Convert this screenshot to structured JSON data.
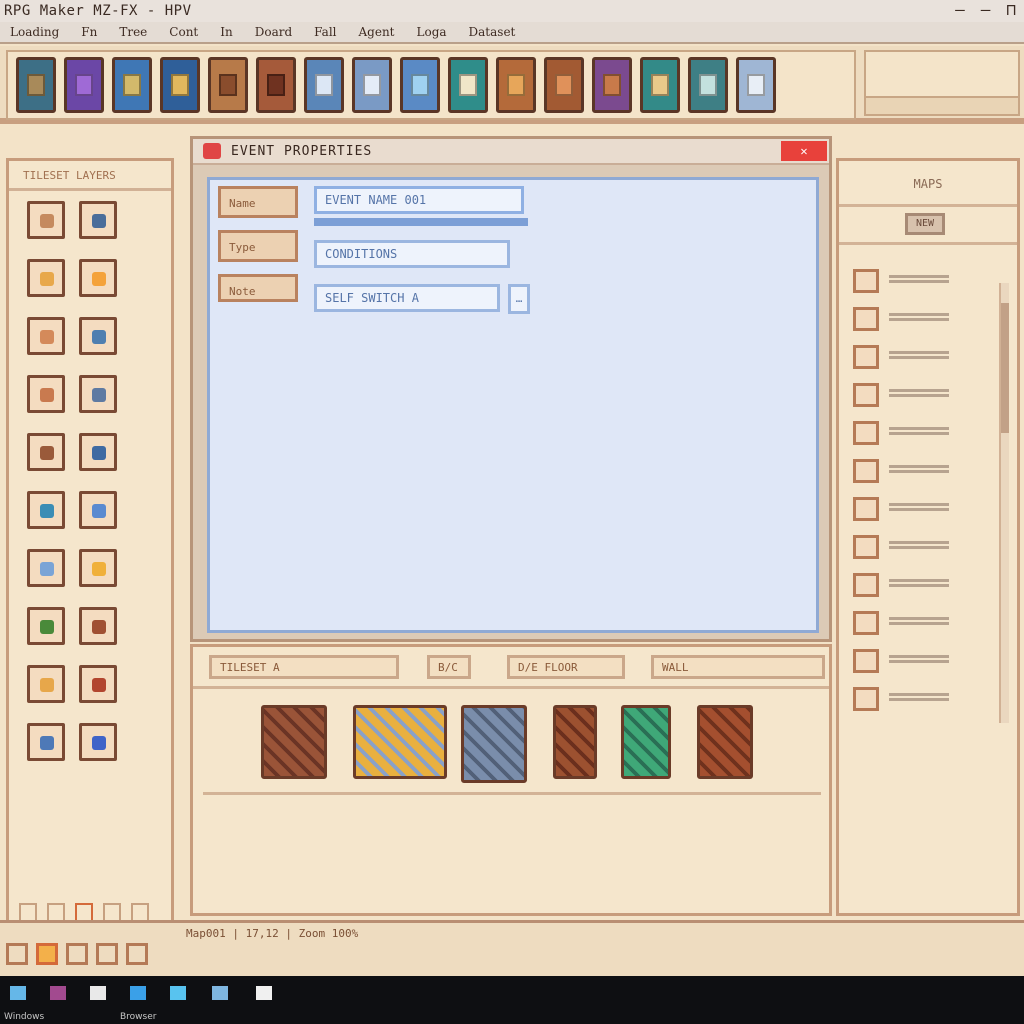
{
  "window": {
    "title": "RPG Maker MZ-FX - HPV",
    "controls": [
      "–",
      "–",
      "⊓"
    ]
  },
  "menu": [
    "Loading",
    "Fn",
    "Tree",
    "Cont",
    "In",
    "Doard",
    "Fall",
    "Agent",
    "Loga",
    "Dataset"
  ],
  "toolbar": {
    "buttons": [
      {
        "name": "map-icon",
        "color": "#3d6f86",
        "accent": "#a88a5a"
      },
      {
        "name": "cart-icon",
        "color": "#6b47a6",
        "accent": "#9f6ad6"
      },
      {
        "name": "sword-icon",
        "color": "#3f77b5",
        "accent": "#d3b96b"
      },
      {
        "name": "shield-icon",
        "color": "#2f5f99",
        "accent": "#e1b85e"
      },
      {
        "name": "tile-brown-icon",
        "color": "#b77a49",
        "accent": "#8a4d2d"
      },
      {
        "name": "tile-red-icon",
        "color": "#a55a3a",
        "accent": "#6f3220"
      },
      {
        "name": "character-icon",
        "color": "#5a86b8",
        "accent": "#dce7f5"
      },
      {
        "name": "save-icon",
        "color": "#7a9ac5",
        "accent": "#e4ecf8"
      },
      {
        "name": "grid-icon",
        "color": "#5a8ac5",
        "accent": "#9fd1f1"
      },
      {
        "name": "chest-icon",
        "color": "#2f8d8a",
        "accent": "#f0e6c8"
      },
      {
        "name": "book-icon",
        "color": "#b46a3a",
        "accent": "#e7a65a"
      },
      {
        "name": "scroll-icon",
        "color": "#a25a33",
        "accent": "#e0915a"
      },
      {
        "name": "bag-icon",
        "color": "#7b4a8f",
        "accent": "#c87a4a"
      },
      {
        "name": "lamp-icon",
        "color": "#338a88",
        "accent": "#e9c98a"
      },
      {
        "name": "gem-icon",
        "color": "#3e7f85",
        "accent": "#c3e1de"
      },
      {
        "name": "image-icon",
        "color": "#9fb6d4",
        "accent": "#e8eef6"
      }
    ]
  },
  "left_panel": {
    "header": "TILESET LAYERS",
    "palette": [
      {
        "name": "tile-a1-icon",
        "color": "#c58a5e"
      },
      {
        "name": "tile-a2-icon",
        "color": "#4a6d9a"
      },
      {
        "name": "tile-b1-icon",
        "color": "#e8a84a"
      },
      {
        "name": "tile-b2-icon",
        "color": "#f4a23a"
      },
      {
        "name": "tile-c1-icon",
        "color": "#d48a5a"
      },
      {
        "name": "tile-c2-icon",
        "color": "#4f7fb0"
      },
      {
        "name": "tile-d1-icon",
        "color": "#c97a4f"
      },
      {
        "name": "tile-d2-icon",
        "color": "#5e7aa2"
      },
      {
        "name": "tile-e1-icon",
        "color": "#9a5a3a"
      },
      {
        "name": "tile-e2-icon",
        "color": "#3f6aa2"
      },
      {
        "name": "tile-f1-icon",
        "color": "#3b8db5"
      },
      {
        "name": "tile-f2-icon",
        "color": "#5a8ad0"
      },
      {
        "name": "tile-g1-icon",
        "color": "#7aa4d6"
      },
      {
        "name": "tile-g2-icon",
        "color": "#f0b03a"
      },
      {
        "name": "tile-h1-icon",
        "color": "#4a8a3a"
      },
      {
        "name": "tile-h2-icon",
        "color": "#a05032"
      },
      {
        "name": "tile-i1-icon",
        "color": "#e7a74a"
      },
      {
        "name": "tile-i2-icon",
        "color": "#b2452e"
      },
      {
        "name": "tile-j1-icon",
        "color": "#4e79b7"
      },
      {
        "name": "tile-j2-icon",
        "color": "#3f63c8"
      }
    ]
  },
  "dialog": {
    "title": "EVENT PROPERTIES",
    "close": "✕",
    "sidebar": [
      "Name",
      "Type",
      "Note"
    ],
    "fields": [
      "EVENT NAME 001",
      "CONDITIONS",
      "SELF SWITCH A"
    ],
    "button": "…"
  },
  "tileset": {
    "tabs": [
      "TILESET A",
      "B/C",
      "D/E FLOOR",
      "WALL"
    ],
    "tiles": [
      {
        "name": "brick-tile",
        "color": "#9a5438",
        "accent": "#6b3425"
      },
      {
        "name": "gold-pattern-tile",
        "color": "#e9b03f",
        "accent": "#8aa1c7"
      },
      {
        "name": "stone-tile",
        "color": "#7a8dab",
        "accent": "#526078"
      },
      {
        "name": "dirt-tile",
        "color": "#9c5130",
        "accent": "#6b2f1d"
      },
      {
        "name": "grass-tile",
        "color": "#3fa878",
        "accent": "#2a6f55"
      },
      {
        "name": "wood-tile",
        "color": "#a44f2f",
        "accent": "#6f311d"
      }
    ]
  },
  "right_panel": {
    "header": "MAPS",
    "button": "NEW"
  },
  "status": {
    "text": "Map001 | 17,12 | Zoom 100%"
  },
  "taskbar": {
    "items": [
      "start",
      "media",
      "notes",
      "browser",
      "files",
      "game",
      "docs"
    ],
    "labels": [
      "Windows",
      "Browser"
    ]
  }
}
